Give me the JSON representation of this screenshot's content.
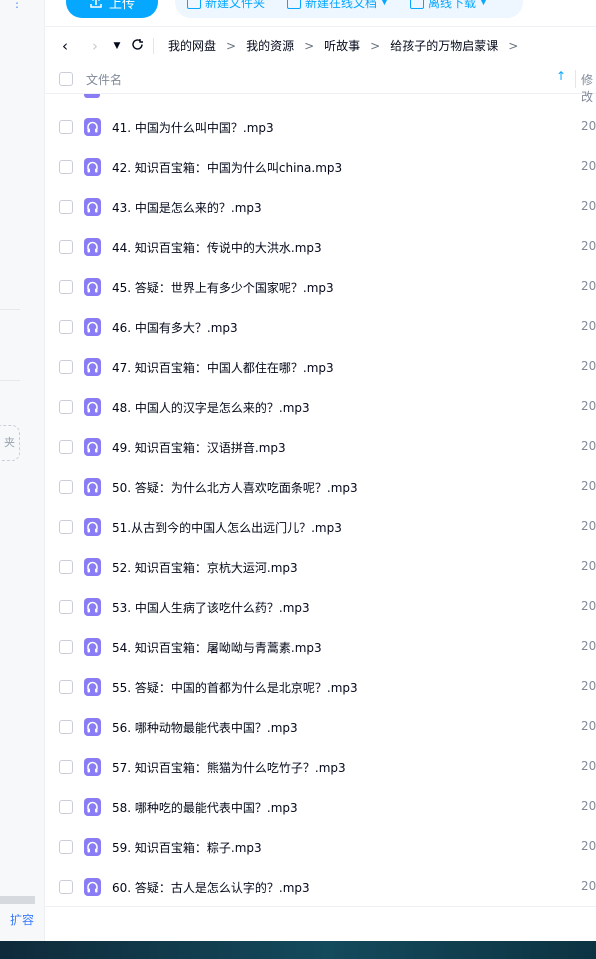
{
  "sidebar": {
    "expand_label": "扩容",
    "new_folder_fragment": "夹"
  },
  "toolbar": {
    "upload_label": "上传",
    "new_folder_label": "新建文件夹",
    "new_online_doc_label": "新建在线文档",
    "offline_download_label": "离线下载"
  },
  "breadcrumb": [
    "我的网盘",
    "我的资源",
    "听故事",
    "给孩子的万物启蒙课"
  ],
  "breadcrumb_separator": ">",
  "table": {
    "header_name": "文件名",
    "header_modified": "修改",
    "rows": [
      {
        "name": "41. 中国为什么叫中国？.mp3",
        "date": "20"
      },
      {
        "name": "42. 知识百宝箱：中国为什么叫china.mp3",
        "date": "20"
      },
      {
        "name": "43. 中国是怎么来的？.mp3",
        "date": "20"
      },
      {
        "name": "44. 知识百宝箱：传说中的大洪水.mp3",
        "date": "20"
      },
      {
        "name": "45. 答疑：世界上有多少个国家呢？.mp3",
        "date": "20"
      },
      {
        "name": "46. 中国有多大？.mp3",
        "date": "20"
      },
      {
        "name": "47. 知识百宝箱：中国人都住在哪？.mp3",
        "date": "20"
      },
      {
        "name": "48. 中国人的汉字是怎么来的？.mp3",
        "date": "20"
      },
      {
        "name": "49. 知识百宝箱：汉语拼音.mp3",
        "date": "20"
      },
      {
        "name": "50. 答疑：为什么北方人喜欢吃面条呢？.mp3",
        "date": "20"
      },
      {
        "name": "51.从古到今的中国人怎么出远门儿？.mp3",
        "date": "20"
      },
      {
        "name": "52. 知识百宝箱：京杭大运河.mp3",
        "date": "20"
      },
      {
        "name": "53. 中国人生病了该吃什么药？.mp3",
        "date": "20"
      },
      {
        "name": "54. 知识百宝箱：屠呦呦与青蒿素.mp3",
        "date": "20"
      },
      {
        "name": "55. 答疑：中国的首都为什么是北京呢？.mp3",
        "date": "20"
      },
      {
        "name": "56. 哪种动物最能代表中国？.mp3",
        "date": "20"
      },
      {
        "name": "57. 知识百宝箱：熊猫为什么吃竹子？.mp3",
        "date": "20"
      },
      {
        "name": "58. 哪种吃的最能代表中国？.mp3",
        "date": "20"
      },
      {
        "name": "59. 知识百宝箱：粽子.mp3",
        "date": "20"
      },
      {
        "name": "60. 答疑：古人是怎么认字的？.mp3",
        "date": "20"
      }
    ]
  },
  "colors": {
    "accent": "#06a7ff",
    "audio_icon": "#8a7cf5",
    "text": "#03081a",
    "muted": "#818999"
  },
  "icons": {
    "upload": "upload-icon",
    "new_folder": "folder-plus-icon",
    "online_doc": "doc-plus-icon",
    "download": "download-icon",
    "back": "chevron-left-icon",
    "forward": "chevron-right-icon",
    "history": "caret-down-icon",
    "refresh": "refresh-icon",
    "sort": "arrow-up-icon",
    "file": "audio-file-icon"
  }
}
